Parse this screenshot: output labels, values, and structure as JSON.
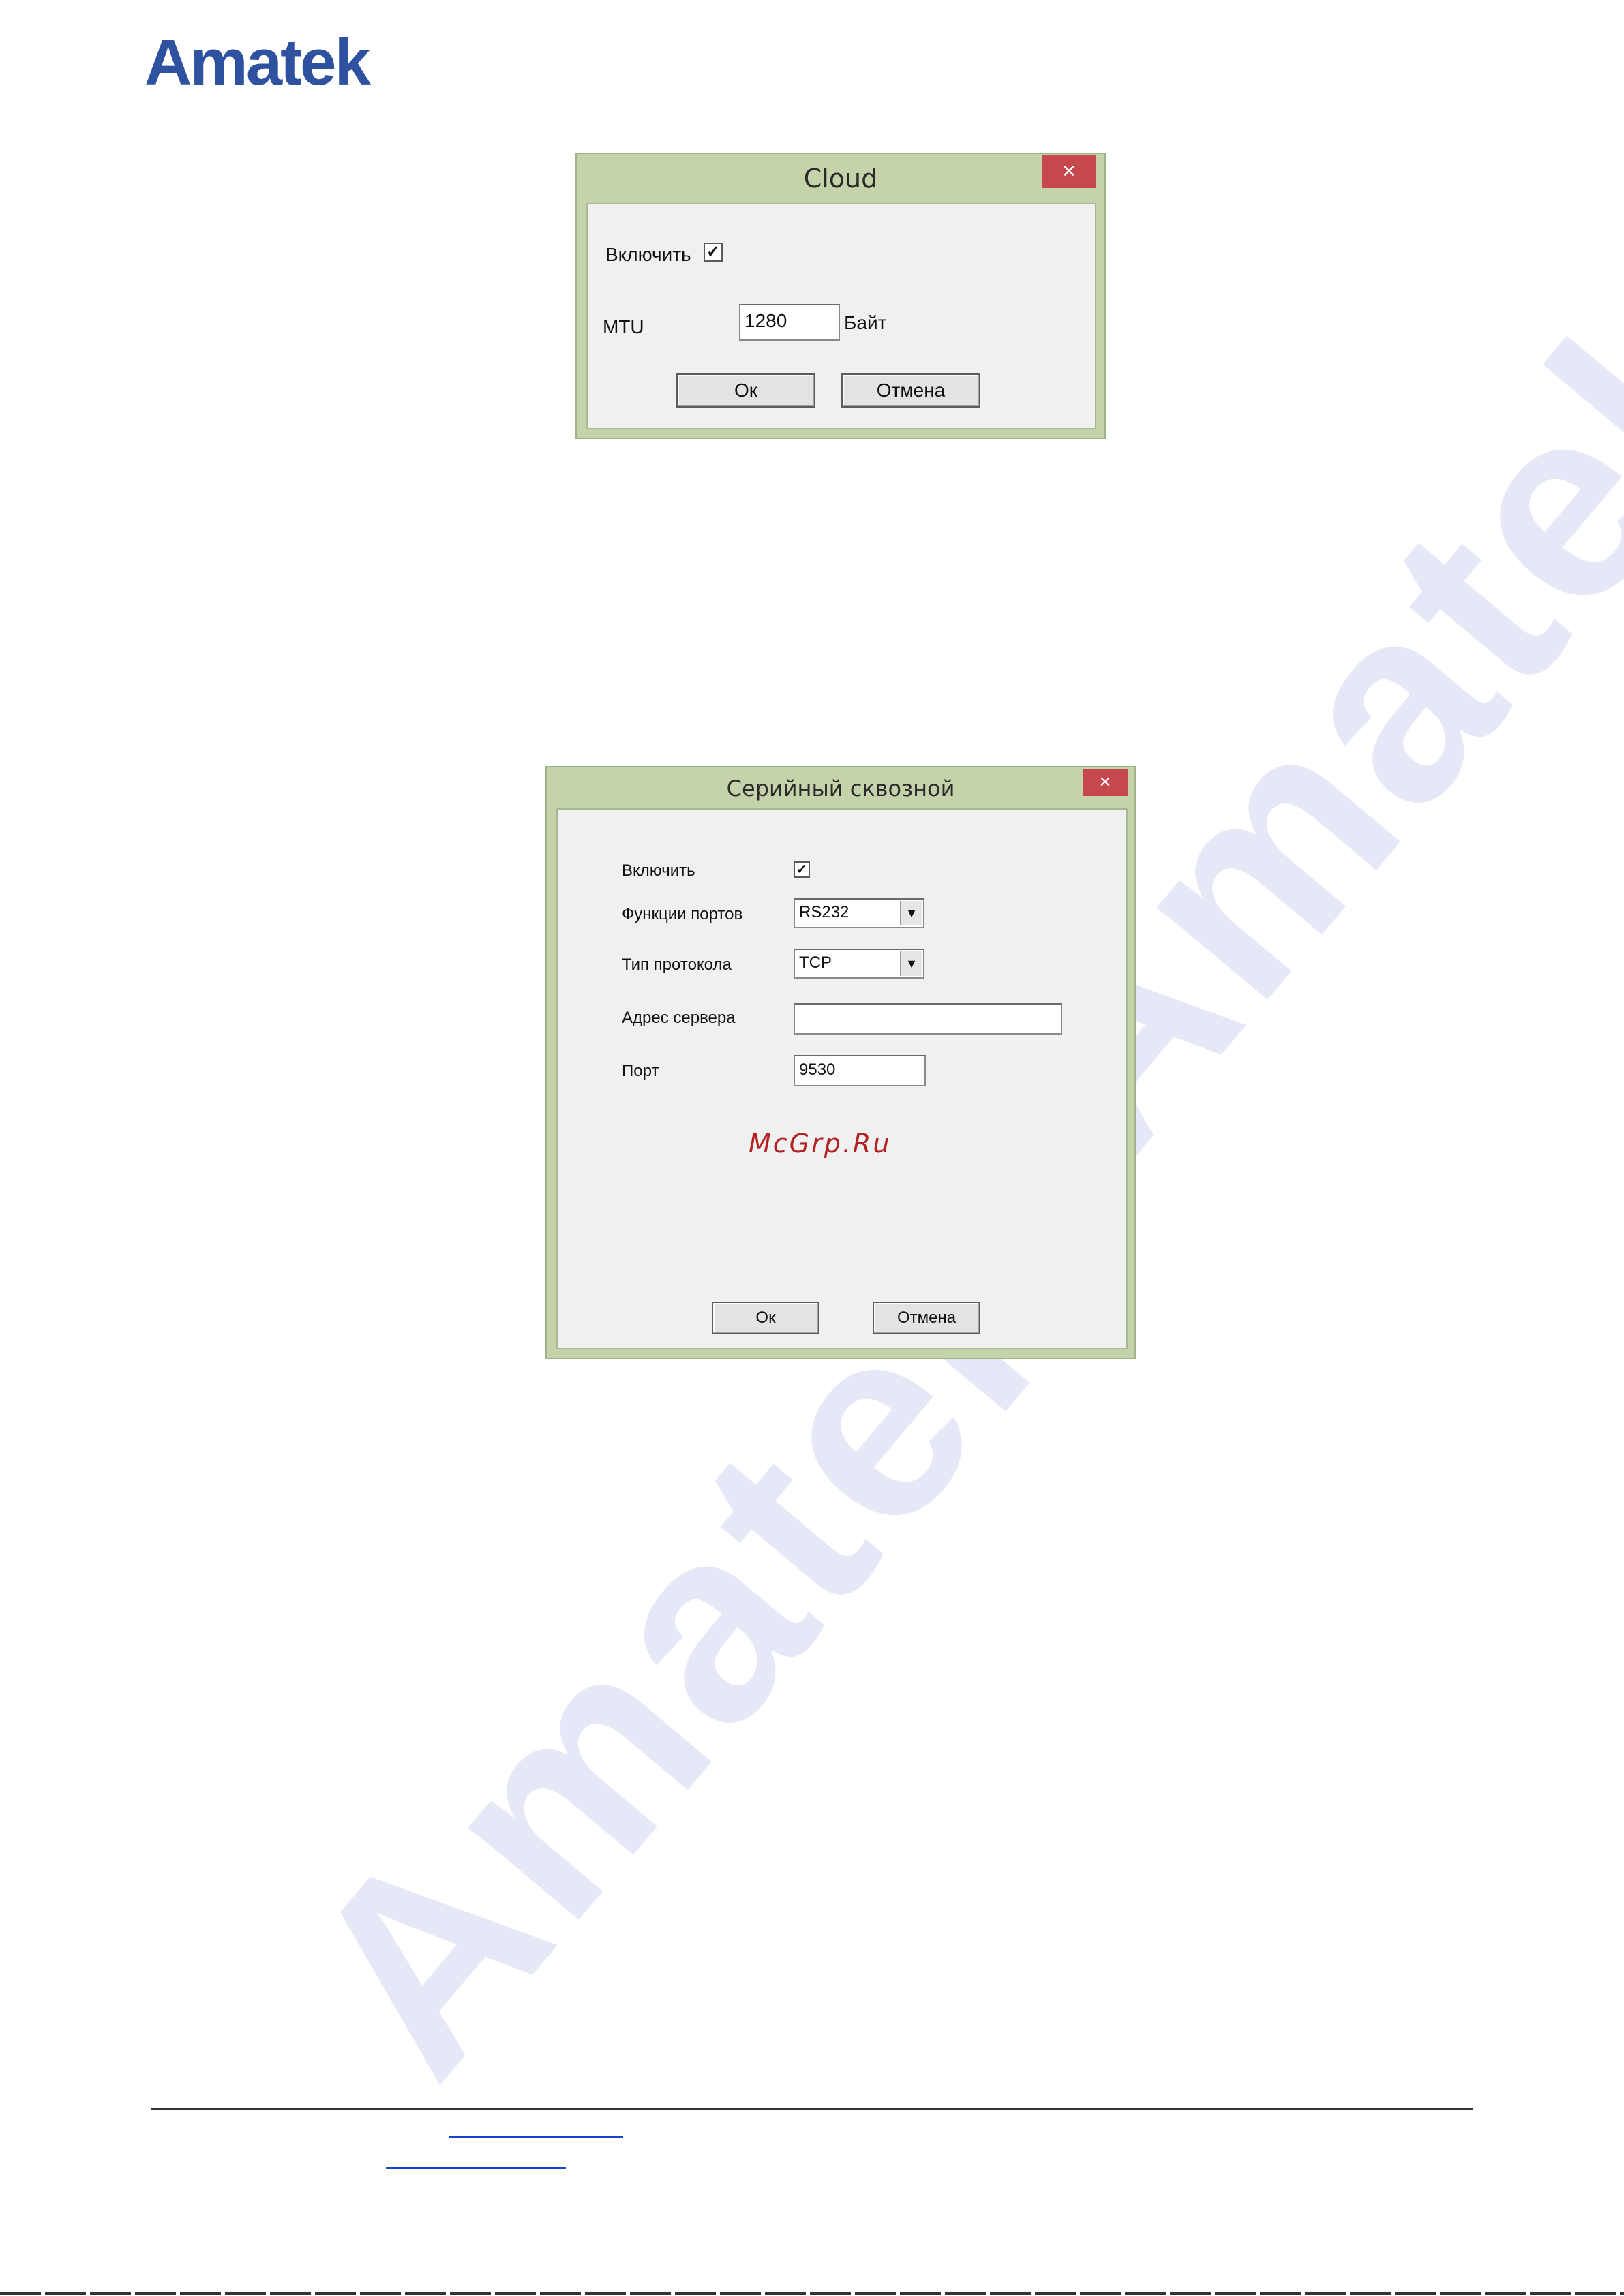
{
  "header": {
    "logo_text": "Amatek"
  },
  "watermark": {
    "text": "Amatek"
  },
  "dialogs": {
    "cloud": {
      "title": "Cloud",
      "close_glyph": "✕",
      "enable_label": "Включить",
      "enable_checked": true,
      "check_glyph": "✓",
      "mtu_label": "MTU",
      "mtu_value": "1280",
      "mtu_unit": "Байт",
      "ok_label": "Ок",
      "cancel_label": "Отмена"
    },
    "serial": {
      "title": "Серийный сквозной",
      "close_glyph": "✕",
      "enable_label": "Включить",
      "enable_checked": true,
      "check_glyph": "✓",
      "port_function_label": "Функции портов",
      "port_function_value": "RS232",
      "protocol_label": "Тип протокола",
      "protocol_value": "TCP",
      "server_address_label": "Адрес сервера",
      "server_address_value": "",
      "port_label": "Порт",
      "port_value": "9530",
      "dropdown_glyph": "▼",
      "ok_label": "Ок",
      "cancel_label": "Отмена"
    }
  },
  "stamp": {
    "text": "McGrp.Ru"
  },
  "colors": {
    "logo": "#2f52a0",
    "titlebar": "#c4d3aa",
    "close_button": "#c7484c",
    "watermark": "#e6e8f8",
    "stamp": "#b22222",
    "link": "#1a3fd0"
  }
}
